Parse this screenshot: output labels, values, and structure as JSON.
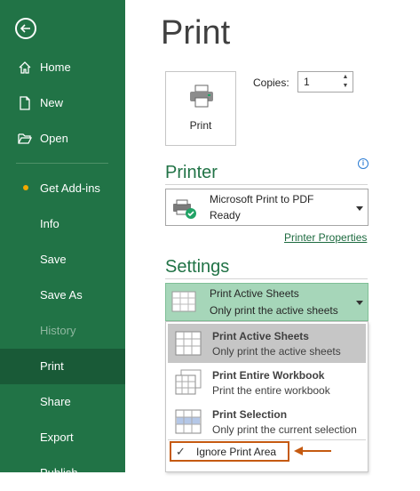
{
  "sidebar": {
    "back_icon": "back-arrow-icon",
    "items": [
      {
        "label": "Home",
        "icon": "home-icon"
      },
      {
        "label": "New",
        "icon": "new-document-icon"
      },
      {
        "label": "Open",
        "icon": "open-folder-icon"
      },
      {
        "label": "Get Add-ins",
        "icon": "dot-badge"
      },
      {
        "label": "Info"
      },
      {
        "label": "Save"
      },
      {
        "label": "Save As"
      },
      {
        "label": "History",
        "disabled": true
      },
      {
        "label": "Print",
        "active": true
      },
      {
        "label": "Share"
      },
      {
        "label": "Export"
      },
      {
        "label": "Publish"
      }
    ]
  },
  "main": {
    "title": "Print",
    "print_button": {
      "label": "Print",
      "icon": "printer-icon"
    },
    "copies": {
      "label": "Copies:",
      "value": "1"
    },
    "printer": {
      "heading": "Printer",
      "info_icon": "info-icon",
      "name": "Microsoft Print to PDF",
      "status": "Ready",
      "properties_link": "Printer Properties"
    },
    "settings": {
      "heading": "Settings",
      "selected": {
        "title": "Print Active Sheets",
        "desc": "Only print the active sheets"
      },
      "options": [
        {
          "title": "Print Active Sheets",
          "desc": "Only print the active sheets",
          "selected": true
        },
        {
          "title": "Print Entire Workbook",
          "desc": "Print the entire workbook"
        },
        {
          "title": "Print Selection",
          "desc": "Only print the current selection"
        }
      ],
      "ignore_print_area": {
        "label": "Ignore Print Area",
        "checked": true
      }
    }
  },
  "colors": {
    "sidebar": "#217346",
    "sidebar_active": "#195a37",
    "accent": "#217346",
    "highlight_dropdown": "#a6d6b9",
    "annotation": "#c55a11"
  }
}
